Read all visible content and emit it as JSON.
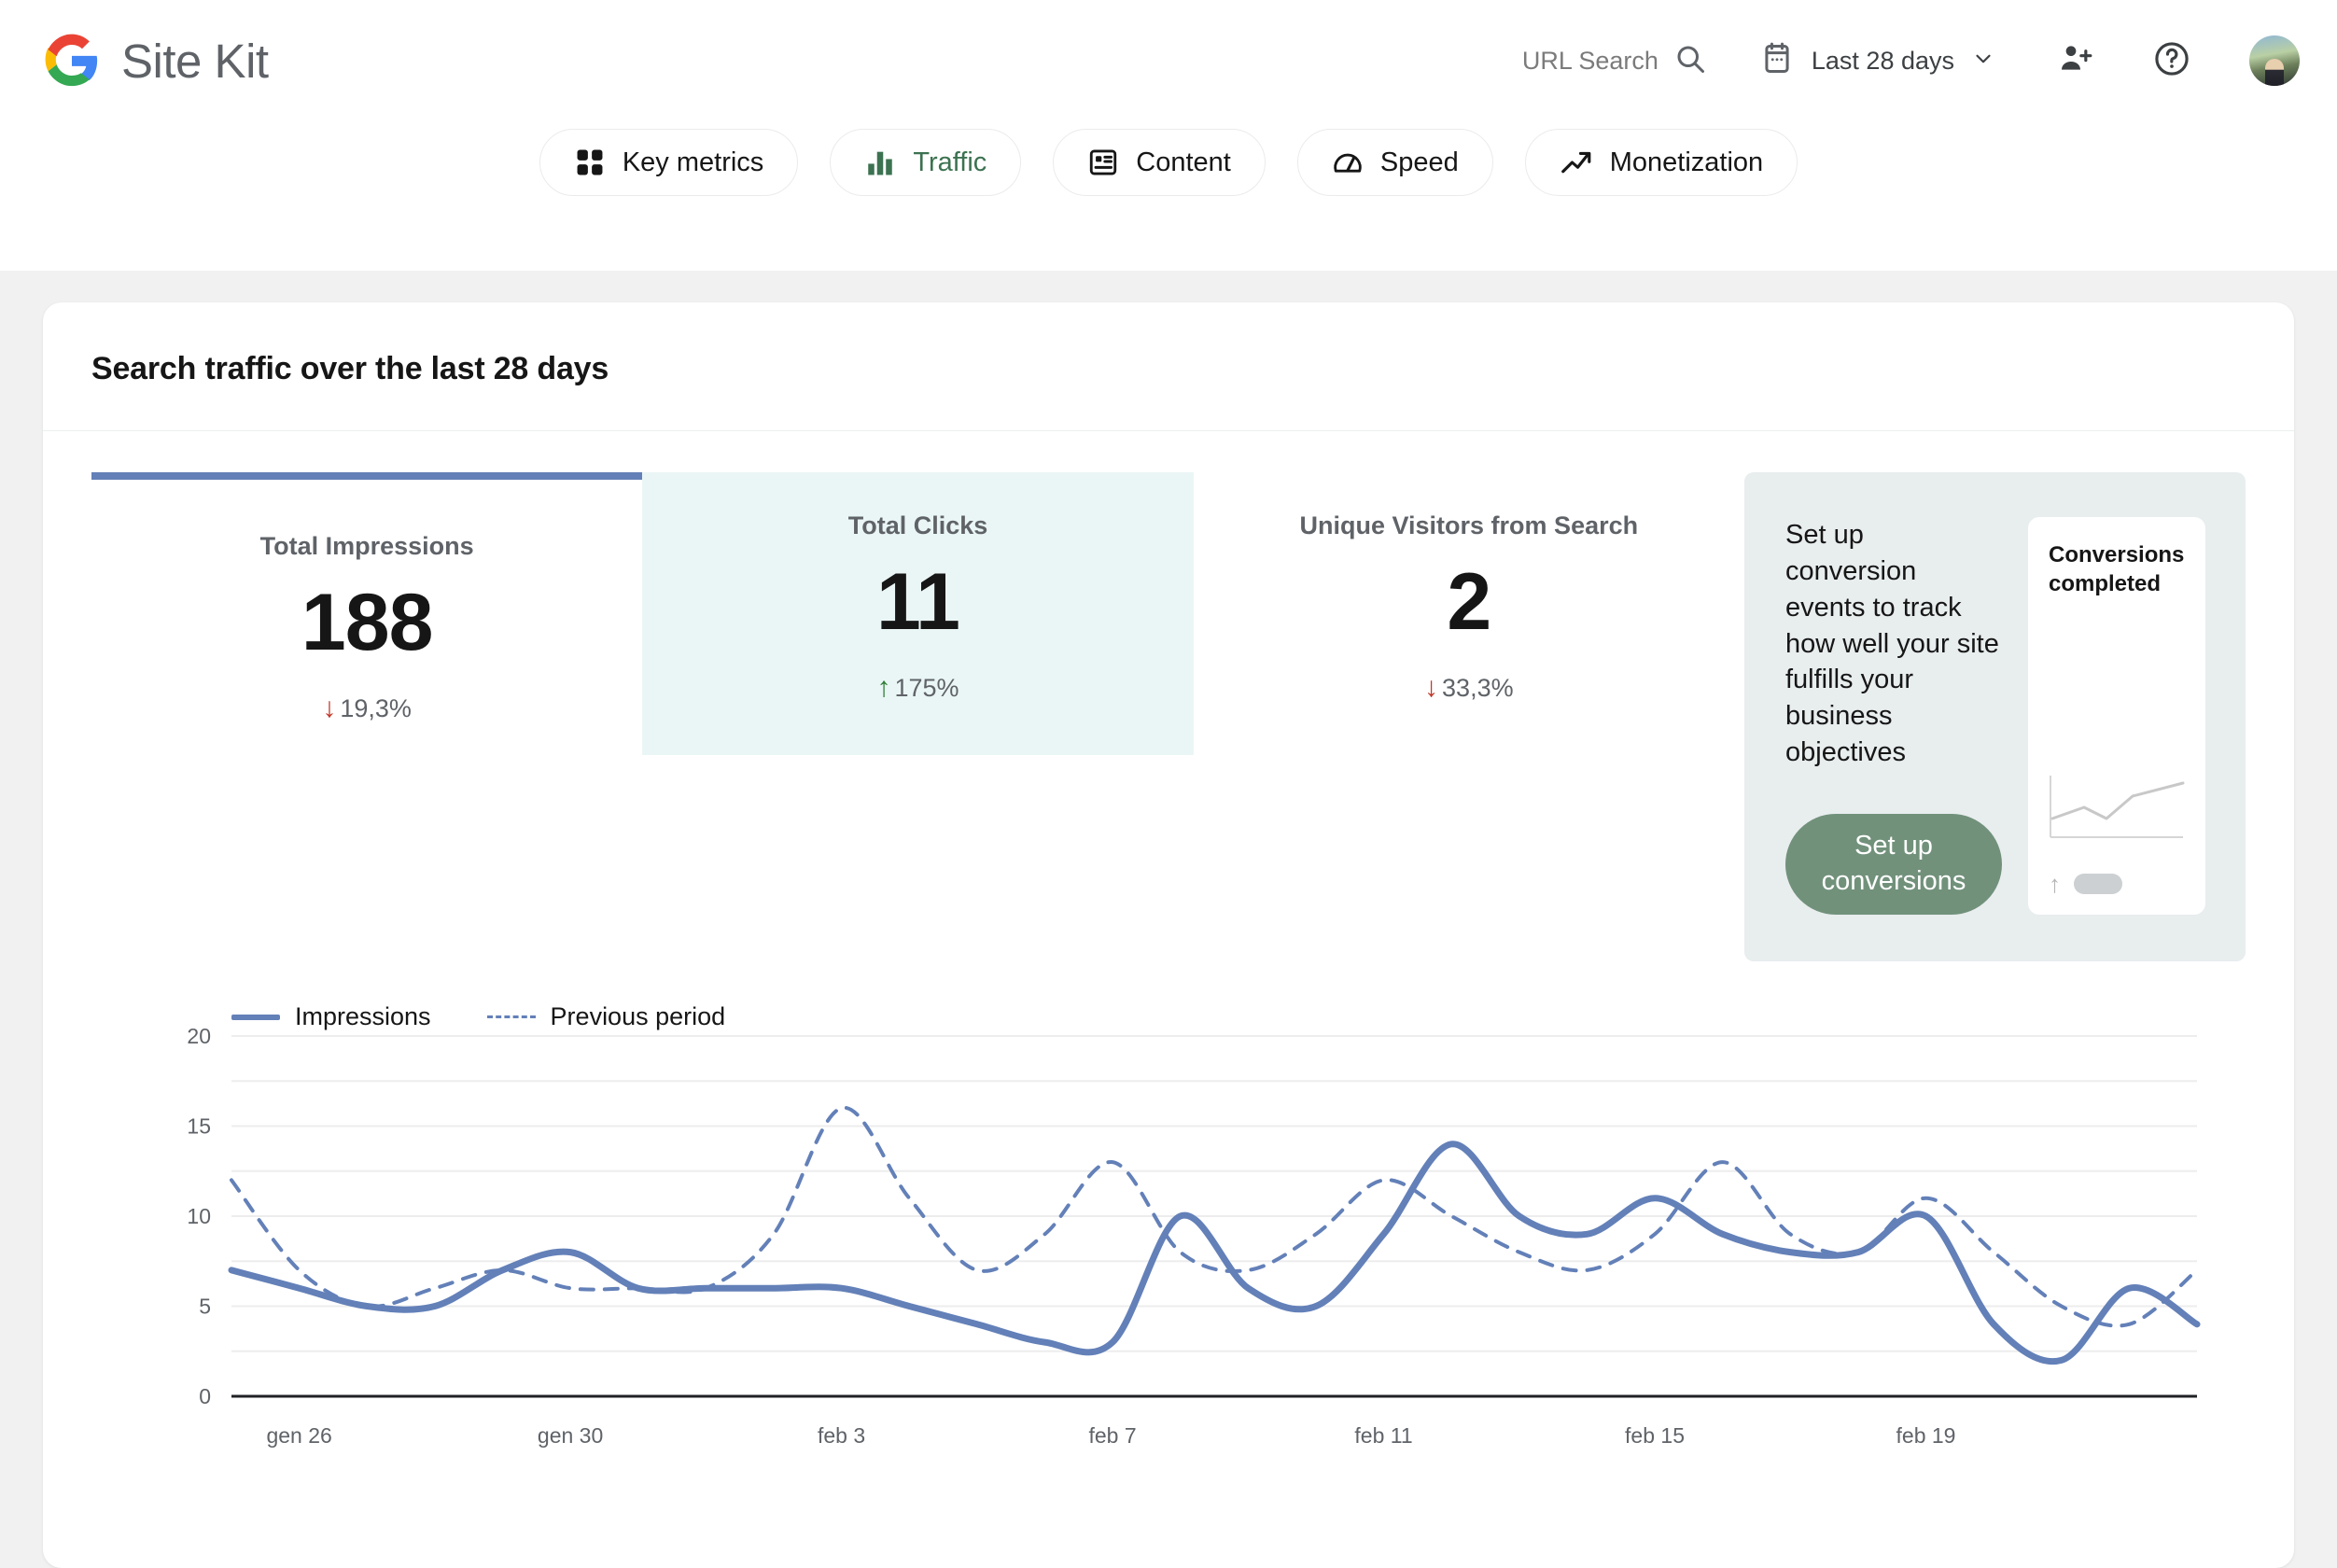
{
  "header": {
    "brand": "Site Kit",
    "url_search_label": "URL Search",
    "date_range_label": "Last 28 days"
  },
  "nav": {
    "tabs": [
      {
        "label": "Key metrics",
        "icon": "grid-icon",
        "active": false
      },
      {
        "label": "Traffic",
        "icon": "bar-chart-icon",
        "active": true
      },
      {
        "label": "Content",
        "icon": "article-icon",
        "active": false
      },
      {
        "label": "Speed",
        "icon": "speedometer-icon",
        "active": false
      },
      {
        "label": "Monetization",
        "icon": "trending-up-icon",
        "active": false
      }
    ]
  },
  "card": {
    "title": "Search traffic over the last 28 days",
    "metrics": [
      {
        "label": "Total Impressions",
        "value": "188",
        "delta": "19,3%",
        "direction": "down"
      },
      {
        "label": "Total Clicks",
        "value": "11",
        "delta": "175%",
        "direction": "up"
      },
      {
        "label": "Unique Visitors from Search",
        "value": "2",
        "delta": "33,3%",
        "direction": "down"
      }
    ],
    "cta": {
      "text": "Set up conversion events to track how well your site fulfills your business objectives",
      "button_label": "Set up conversions",
      "preview_title": "Conversions completed"
    }
  },
  "chart_data": {
    "type": "line",
    "title": "Search traffic over the last 28 days",
    "xlabel": "",
    "ylabel": "",
    "ylim": [
      0,
      20
    ],
    "yticks": [
      0,
      5,
      10,
      15,
      20
    ],
    "gridline_step": 2.5,
    "grid": true,
    "legend_position": "top-left",
    "x_tick_labels": [
      "gen 26",
      "gen 30",
      "feb 3",
      "feb 7",
      "feb 11",
      "feb 15",
      "feb 19"
    ],
    "x_tick_indices": [
      1,
      5,
      9,
      13,
      17,
      21,
      25
    ],
    "x": [
      "gen 25",
      "gen 26",
      "gen 27",
      "gen 28",
      "gen 29",
      "gen 30",
      "gen 31",
      "feb 1",
      "feb 2",
      "feb 3",
      "feb 4",
      "feb 5",
      "feb 6",
      "feb 7",
      "feb 8",
      "feb 9",
      "feb 10",
      "feb 11",
      "feb 12",
      "feb 13",
      "feb 14",
      "feb 15",
      "feb 16",
      "feb 17",
      "feb 18",
      "feb 19",
      "feb 20",
      "feb 21"
    ],
    "series": [
      {
        "name": "Impressions",
        "style": "solid",
        "color": "#6380b8",
        "values": [
          7,
          6,
          5,
          5,
          7,
          8,
          6,
          6,
          6,
          6,
          5,
          4,
          3,
          3,
          10,
          6,
          5,
          9,
          14,
          10,
          9,
          11,
          9,
          8,
          8,
          10,
          4,
          2,
          6,
          4
        ]
      },
      {
        "name": "Previous period",
        "style": "dashed",
        "color": "#6380b8",
        "values": [
          12,
          7,
          5,
          6,
          7,
          6,
          6,
          6,
          9,
          16,
          11,
          7,
          9,
          13,
          8,
          7,
          9,
          12,
          10,
          8,
          7,
          9,
          13,
          9,
          8,
          11,
          8,
          5,
          4,
          7
        ]
      }
    ]
  }
}
